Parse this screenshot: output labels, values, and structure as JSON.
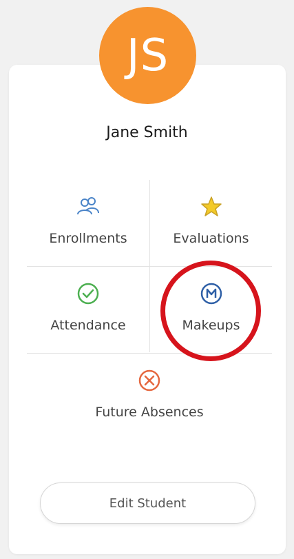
{
  "student": {
    "initials": "JS",
    "name": "Jane Smith"
  },
  "tiles": [
    {
      "label": "Enrollments",
      "icon": "users-icon"
    },
    {
      "label": "Evaluations",
      "icon": "star-icon"
    },
    {
      "label": "Attendance",
      "icon": "check-circle-icon"
    },
    {
      "label": "Makeups",
      "icon": "makeup-m-icon"
    },
    {
      "label": "Future Absences",
      "icon": "x-circle-icon"
    }
  ],
  "actions": {
    "edit_label": "Edit Student"
  },
  "colors": {
    "avatar": "#F7932F",
    "enroll_icon": "#4A84C8",
    "star_icon": "#F3CA2A",
    "check_icon": "#4CAF50",
    "makeup_icon": "#2E5FA6",
    "x_icon": "#E5673E",
    "annotation": "#D6141C"
  }
}
